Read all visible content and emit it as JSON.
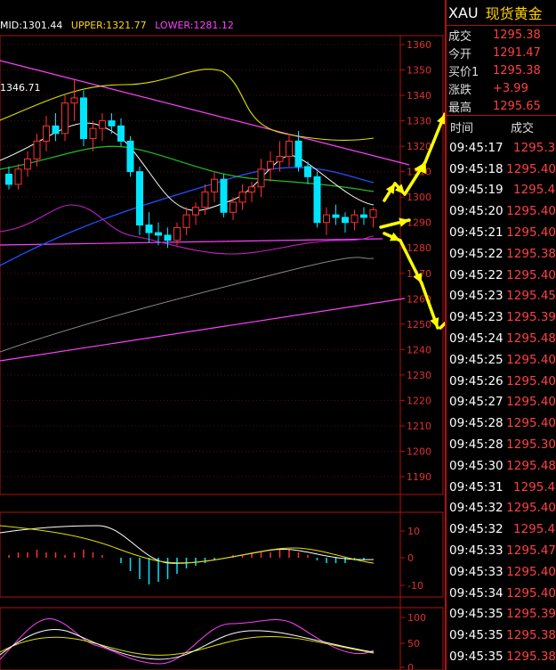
{
  "indicator_bar": {
    "mid": "MID:1301.44",
    "upper": "UPPER:1321.77",
    "lower": "LOWER:1281.12",
    "mid_color": "#ffffff",
    "upper_color": "#ffd700",
    "lower_color": "#ff40ff"
  },
  "main_chart": {
    "y_ticks": [
      "1360",
      "1350",
      "1340",
      "1330",
      "1320",
      "1310",
      "1300",
      "1290",
      "1280",
      "1270",
      "1260",
      "1250",
      "1240",
      "1230",
      "1220",
      "1210",
      "1200",
      "1190"
    ],
    "high_label": "1346.71"
  },
  "macd_panel": {
    "y_ticks": [
      "10",
      "0",
      "-10"
    ]
  },
  "kdj_panel": {
    "y_ticks": [
      "100",
      "50",
      "0"
    ]
  },
  "quote": {
    "symbol": "XAU",
    "name": "现货黄金",
    "rows": [
      {
        "label": "成交",
        "value": "1295.38"
      },
      {
        "label": "今开",
        "value": "1291.47"
      },
      {
        "label": "买价1",
        "value": "1295.38"
      },
      {
        "label": "涨跌",
        "value": "+3.99"
      },
      {
        "label": "最高",
        "value": "1295.65"
      }
    ]
  },
  "trades": {
    "col_time": "时间",
    "col_price": "成交",
    "rows": [
      {
        "time": "09:45:17",
        "price": "1295.3"
      },
      {
        "time": "09:45:18",
        "price": "1295.40"
      },
      {
        "time": "09:45:19",
        "price": "1295.4"
      },
      {
        "time": "09:45:20",
        "price": "1295.40"
      },
      {
        "time": "09:45:21",
        "price": "1295.40"
      },
      {
        "time": "09:45:22",
        "price": "1295.38"
      },
      {
        "time": "09:45:22",
        "price": "1295.40"
      },
      {
        "time": "09:45:23",
        "price": "1295.45"
      },
      {
        "time": "09:45:23",
        "price": "1295.39"
      },
      {
        "time": "09:45:24",
        "price": "1295.48"
      },
      {
        "time": "09:45:25",
        "price": "1295.40"
      },
      {
        "time": "09:45:26",
        "price": "1295.40"
      },
      {
        "time": "09:45:27",
        "price": "1295.40"
      },
      {
        "time": "09:45:28",
        "price": "1295.40"
      },
      {
        "time": "09:45:28",
        "price": "1295.30"
      },
      {
        "time": "09:45:30",
        "price": "1295.48"
      },
      {
        "time": "09:45:31",
        "price": "1295.4"
      },
      {
        "time": "09:45:32",
        "price": "1295.40"
      },
      {
        "time": "09:45:32",
        "price": "1295.4"
      },
      {
        "time": "09:45:33",
        "price": "1295.47"
      },
      {
        "time": "09:45:33",
        "price": "1295.40"
      },
      {
        "time": "09:45:34",
        "price": "1295.40"
      },
      {
        "time": "09:45:35",
        "price": "1295.39"
      },
      {
        "time": "09:45:35",
        "price": "1295.38"
      },
      {
        "time": "09:45:35",
        "price": "1295.38"
      }
    ]
  },
  "colors": {
    "up": "#ff3030",
    "down": "#00e5ff",
    "trend_line": "#ff40ff",
    "arrow": "#ffff00",
    "panel_border": "#b01010"
  },
  "candles": [
    {
      "o": 1309,
      "h": 1312,
      "l": 1303,
      "c": 1305
    },
    {
      "o": 1305,
      "h": 1313,
      "l": 1303,
      "c": 1311
    },
    {
      "o": 1311,
      "h": 1318,
      "l": 1308,
      "c": 1315
    },
    {
      "o": 1315,
      "h": 1325,
      "l": 1312,
      "c": 1322
    },
    {
      "o": 1322,
      "h": 1332,
      "l": 1318,
      "c": 1328
    },
    {
      "o": 1328,
      "h": 1333,
      "l": 1322,
      "c": 1325
    },
    {
      "o": 1325,
      "h": 1340,
      "l": 1322,
      "c": 1337
    },
    {
      "o": 1337,
      "h": 1346,
      "l": 1330,
      "c": 1339
    },
    {
      "o": 1339,
      "h": 1342,
      "l": 1320,
      "c": 1323
    },
    {
      "o": 1323,
      "h": 1330,
      "l": 1318,
      "c": 1327
    },
    {
      "o": 1327,
      "h": 1333,
      "l": 1322,
      "c": 1330
    },
    {
      "o": 1330,
      "h": 1333,
      "l": 1325,
      "c": 1328
    },
    {
      "o": 1328,
      "h": 1331,
      "l": 1320,
      "c": 1322
    },
    {
      "o": 1322,
      "h": 1324,
      "l": 1308,
      "c": 1310
    },
    {
      "o": 1310,
      "h": 1312,
      "l": 1285,
      "c": 1289
    },
    {
      "o": 1289,
      "h": 1294,
      "l": 1282,
      "c": 1286
    },
    {
      "o": 1286,
      "h": 1290,
      "l": 1281,
      "c": 1285
    },
    {
      "o": 1285,
      "h": 1288,
      "l": 1280,
      "c": 1283
    },
    {
      "o": 1283,
      "h": 1290,
      "l": 1281,
      "c": 1288
    },
    {
      "o": 1288,
      "h": 1296,
      "l": 1285,
      "c": 1293
    },
    {
      "o": 1293,
      "h": 1298,
      "l": 1289,
      "c": 1296
    },
    {
      "o": 1296,
      "h": 1305,
      "l": 1293,
      "c": 1302
    },
    {
      "o": 1302,
      "h": 1310,
      "l": 1298,
      "c": 1307
    },
    {
      "o": 1307,
      "h": 1309,
      "l": 1292,
      "c": 1294
    },
    {
      "o": 1294,
      "h": 1300,
      "l": 1291,
      "c": 1298
    },
    {
      "o": 1298,
      "h": 1305,
      "l": 1295,
      "c": 1302
    },
    {
      "o": 1302,
      "h": 1306,
      "l": 1298,
      "c": 1304
    },
    {
      "o": 1304,
      "h": 1315,
      "l": 1300,
      "c": 1311
    },
    {
      "o": 1311,
      "h": 1318,
      "l": 1306,
      "c": 1314
    },
    {
      "o": 1314,
      "h": 1322,
      "l": 1310,
      "c": 1316
    },
    {
      "o": 1316,
      "h": 1325,
      "l": 1312,
      "c": 1322
    },
    {
      "o": 1322,
      "h": 1326,
      "l": 1310,
      "c": 1312
    },
    {
      "o": 1312,
      "h": 1314,
      "l": 1305,
      "c": 1308
    },
    {
      "o": 1308,
      "h": 1310,
      "l": 1288,
      "c": 1290
    },
    {
      "o": 1290,
      "h": 1296,
      "l": 1285,
      "c": 1293
    },
    {
      "o": 1293,
      "h": 1297,
      "l": 1289,
      "c": 1292
    },
    {
      "o": 1292,
      "h": 1294,
      "l": 1286,
      "c": 1290
    },
    {
      "o": 1290,
      "h": 1295,
      "l": 1287,
      "c": 1293
    },
    {
      "o": 1293,
      "h": 1296,
      "l": 1289,
      "c": 1292
    },
    {
      "o": 1292,
      "h": 1296,
      "l": 1288,
      "c": 1295
    }
  ]
}
